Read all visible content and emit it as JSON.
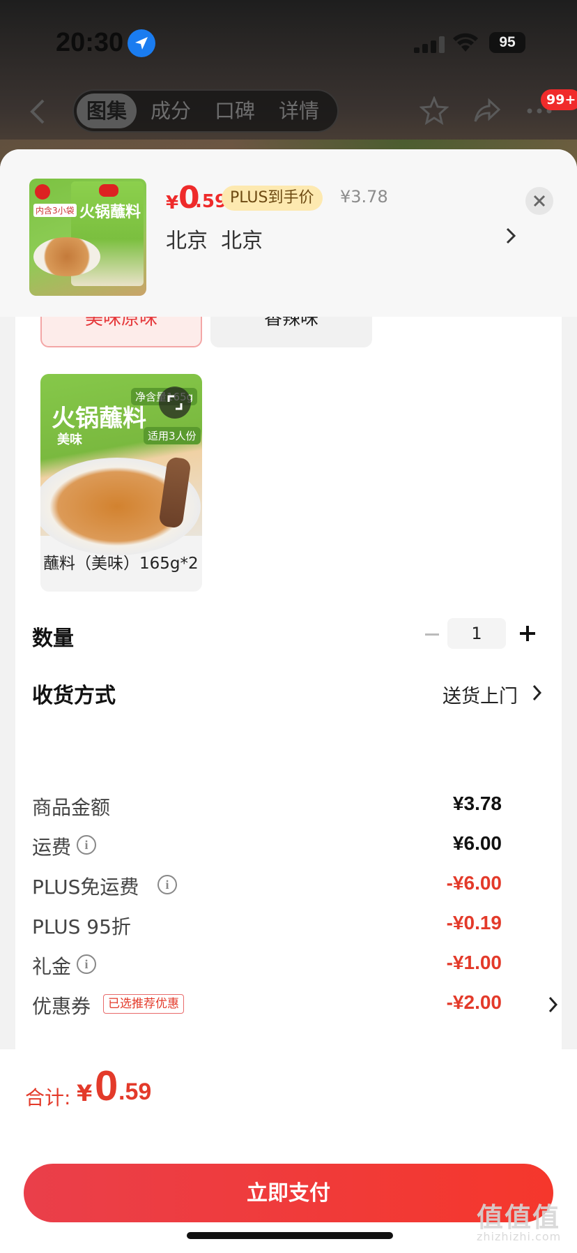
{
  "status_bar": {
    "time": "20:30",
    "battery": "95"
  },
  "nav": {
    "tabs": [
      {
        "label": "图集",
        "active": true
      },
      {
        "label": "成分"
      },
      {
        "label": "口碑"
      },
      {
        "label": "详情"
      }
    ],
    "badge": "99+"
  },
  "sheet": {
    "price": {
      "yen": "¥",
      "integer": "0",
      "decimal": ".59"
    },
    "plus_tag": "PLUS到手价",
    "original_price": "¥3.78",
    "address": "北京  北京",
    "thumbnail": {
      "title": "火锅蘸料",
      "tag": "内含3小袋"
    }
  },
  "variants": {
    "options": [
      {
        "label": "美味原味",
        "selected": true
      },
      {
        "label": "香辣味",
        "selected": false
      }
    ],
    "product": {
      "title": "火锅蘸料",
      "subtitle": "美味",
      "tag1": "净含量165g",
      "tag2": "适用3人份",
      "label": "蘸料（美味）165g*2"
    }
  },
  "quantity": {
    "label": "数量",
    "value": "1"
  },
  "delivery": {
    "label": "收货方式",
    "value": "送货上门"
  },
  "summary": {
    "rows": [
      {
        "label": "商品金额",
        "value": "¥3.78"
      },
      {
        "label": "运费",
        "value": "¥6.00"
      },
      {
        "label": "PLUS免运费",
        "value": "-¥6.00"
      },
      {
        "label": "PLUS 95折",
        "value": "-¥0.19"
      },
      {
        "label": "礼金",
        "value": "-¥1.00"
      },
      {
        "label": "优惠券",
        "value": "-¥2.00",
        "tag": "已选推荐优惠"
      }
    ]
  },
  "footer": {
    "total_label": "合计:",
    "total_yen": "¥",
    "total_integer": "0",
    "total_decimal": ".59",
    "pay_button": "立即支付"
  },
  "watermark": {
    "text": "值值值",
    "sub": "zhizhizhi.com"
  },
  "colors": {
    "accent": "#e33a2a",
    "plus_tag_bg": "#fde9b0",
    "selected_bg": "#fdecea"
  }
}
